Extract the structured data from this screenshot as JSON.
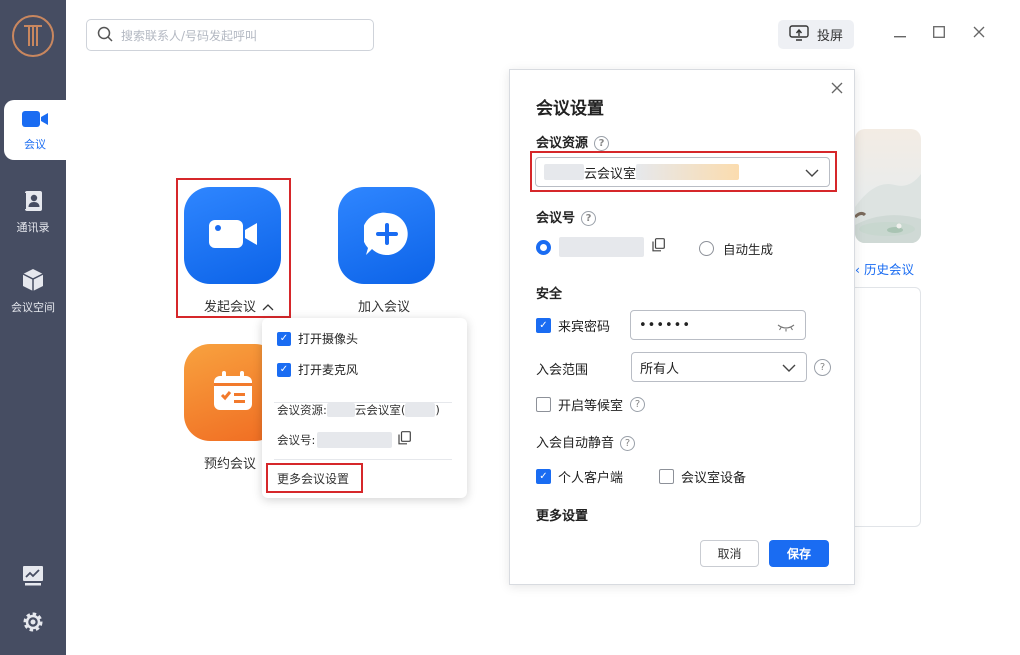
{
  "colors": {
    "accent": "#1a6cf2",
    "sidebar": "#464d62",
    "highlight": "#d6272a",
    "orange": "#f07a2c"
  },
  "search": {
    "placeholder": "搜索联系人/号码发起呼叫"
  },
  "toolbar": {
    "cast_label": "投屏"
  },
  "sidebar": {
    "items": [
      {
        "label": "会议",
        "icon": "video-camera-icon",
        "active": true
      },
      {
        "label": "通讯录",
        "icon": "contacts-icon",
        "active": false
      },
      {
        "label": "会议空间",
        "icon": "cube-icon",
        "active": false
      }
    ],
    "bottom": [
      {
        "icon": "chart-icon"
      },
      {
        "icon": "gear-icon"
      }
    ]
  },
  "tiles": {
    "start": {
      "label": "发起会议",
      "icon": "video-camera-icon"
    },
    "join": {
      "label": "加入会议",
      "icon": "plus-icon"
    },
    "schedule": {
      "label": "预约会议",
      "icon": "calendar-icon"
    }
  },
  "popup": {
    "camera_label": "打开摄像头",
    "camera_checked": true,
    "mic_label": "打开麦克风",
    "mic_checked": true,
    "resource_label": "会议资源:",
    "resource_value": "云会议室(",
    "resource_close": ")",
    "meeting_id_label": "会议号:",
    "more_settings": "更多会议设置"
  },
  "background": {
    "history_link": "历史会议 ›"
  },
  "dialog": {
    "title": "会议设置",
    "resource_label": "会议资源",
    "resource_value": "云会议室",
    "meeting_id_label": "会议号",
    "auto_generate": "自动生成",
    "security_label": "安全",
    "guest_pw_label": "来宾密码",
    "guest_pw_checked": true,
    "guest_pw_value": "••••••",
    "scope_label": "入会范围",
    "scope_value": "所有人",
    "waiting_room_label": "开启等候室",
    "waiting_room_checked": false,
    "auto_mute_label": "入会自动静音",
    "personal_client_label": "个人客户端",
    "personal_client_checked": true,
    "room_device_label": "会议室设备",
    "room_device_checked": false,
    "more_settings_label": "更多设置",
    "cancel": "取消",
    "save": "保存"
  }
}
